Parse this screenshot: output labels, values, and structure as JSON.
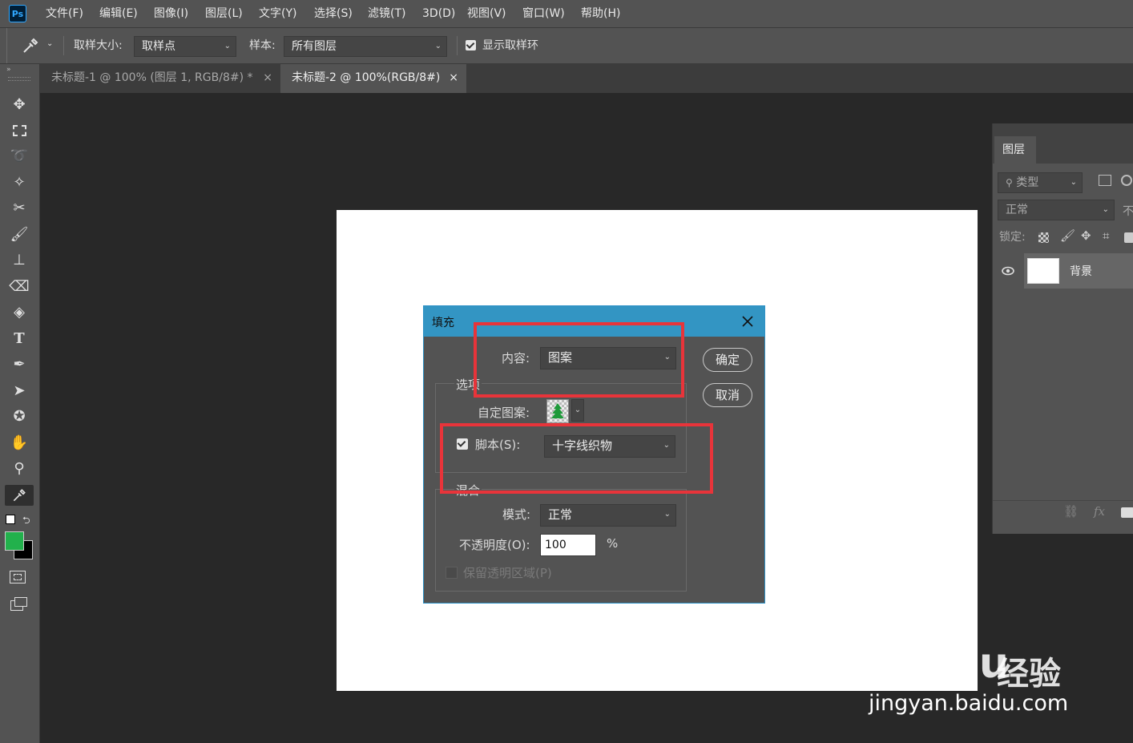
{
  "app": {
    "logo": "Ps"
  },
  "menu": [
    "文件(F)",
    "编辑(E)",
    "图像(I)",
    "图层(L)",
    "文字(Y)",
    "选择(S)",
    "滤镜(T)",
    "3D(D)",
    "视图(V)",
    "窗口(W)",
    "帮助(H)"
  ],
  "options": {
    "sample_size_label": "取样大小:",
    "sample_size_value": "取样点",
    "sample_label": "样本:",
    "sample_value": "所有图层",
    "show_ring_label": "显示取样环"
  },
  "tabs": [
    {
      "label": "未标题-1 @ 100% (图层 1, RGB/8#) *",
      "close": "×"
    },
    {
      "label": "未标题-2 @ 100%(RGB/8#)",
      "close": "×"
    }
  ],
  "layers_panel": {
    "tab": "图层",
    "filter_placeholder": "类型",
    "blend": "正常",
    "opacity_cut": "不",
    "lock_label": "锁定:",
    "layer_name": "背景",
    "fx": "fx"
  },
  "fill_dialog": {
    "title": "填充",
    "content_label": "内容:",
    "content_value": "图案",
    "ok": "确定",
    "cancel": "取消",
    "options_group": "选项",
    "custom_pattern_label": "自定图案:",
    "script_label": "脚本(S):",
    "script_value": "十字线织物",
    "blend_group": "混合",
    "mode_label": "模式:",
    "mode_value": "正常",
    "opacity_label": "不透明度(O):",
    "opacity_value": "100",
    "percent": "%",
    "preserve_label": "保留透明区域(P)"
  },
  "watermark": {
    "site": "jingyan.baidu.com",
    "brand_cn": "经验",
    "brand": "Bai du"
  },
  "colors": {
    "accent": "#3395c3",
    "annotation": "#e8343a",
    "foreground": "#22b14c",
    "background": "#000000"
  }
}
